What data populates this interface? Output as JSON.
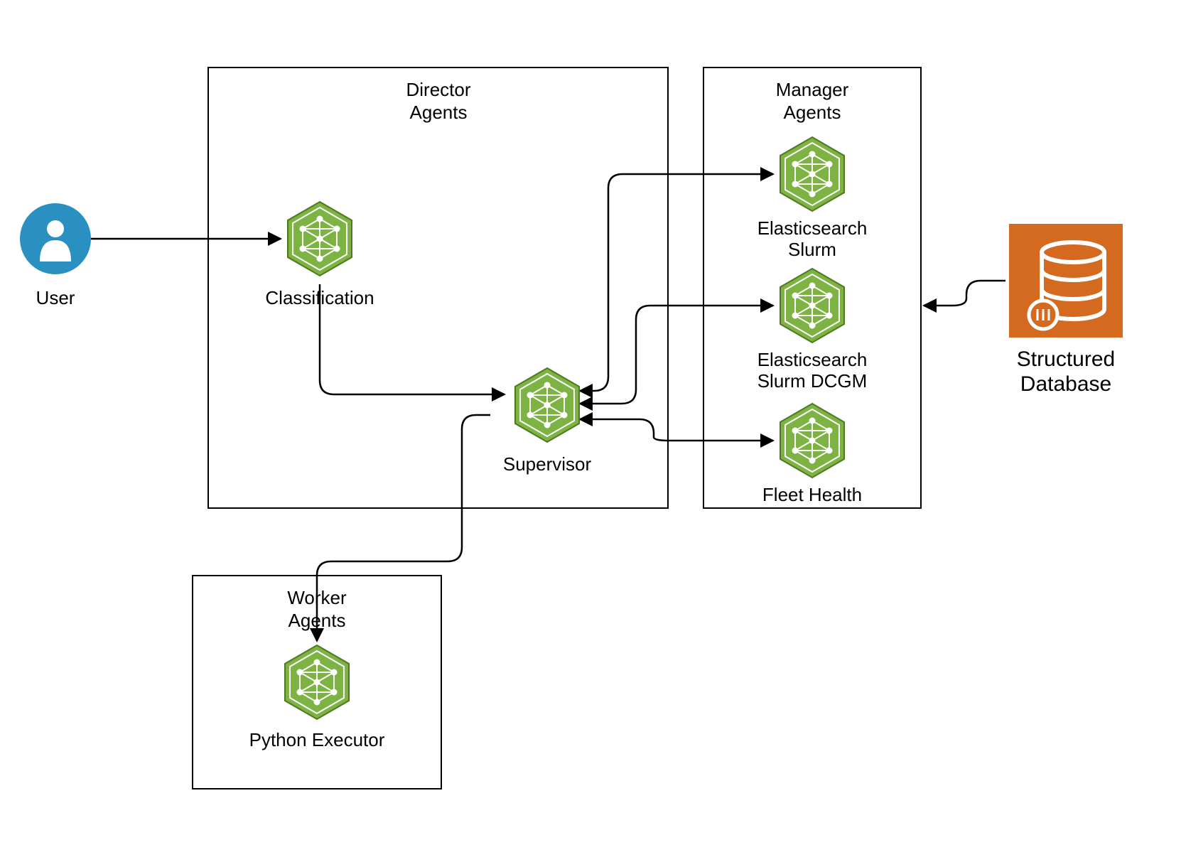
{
  "user": {
    "label": "User"
  },
  "groups": {
    "director": {
      "title_l1": "Director",
      "title_l2": "Agents"
    },
    "manager": {
      "title_l1": "Manager",
      "title_l2": "Agents"
    },
    "worker": {
      "title_l1": "Worker",
      "title_l2": "Agents"
    }
  },
  "nodes": {
    "classification": {
      "label": "Classification"
    },
    "supervisor": {
      "label": "Supervisor"
    },
    "es_slurm": {
      "label_l1": "Elasticsearch",
      "label_l2": "Slurm"
    },
    "es_slurm_dcgm": {
      "label_l1": "Elasticsearch",
      "label_l2": "Slurm DCGM"
    },
    "fleet_health": {
      "label": "Fleet Health"
    },
    "python_exec": {
      "label": "Python Executor"
    }
  },
  "database": {
    "label_l1": "Structured",
    "label_l2": "Database"
  },
  "colors": {
    "agent_green": "#7cb342",
    "user_blue": "#2a8fc1",
    "db_orange": "#d46a1f",
    "stroke": "#000000"
  }
}
